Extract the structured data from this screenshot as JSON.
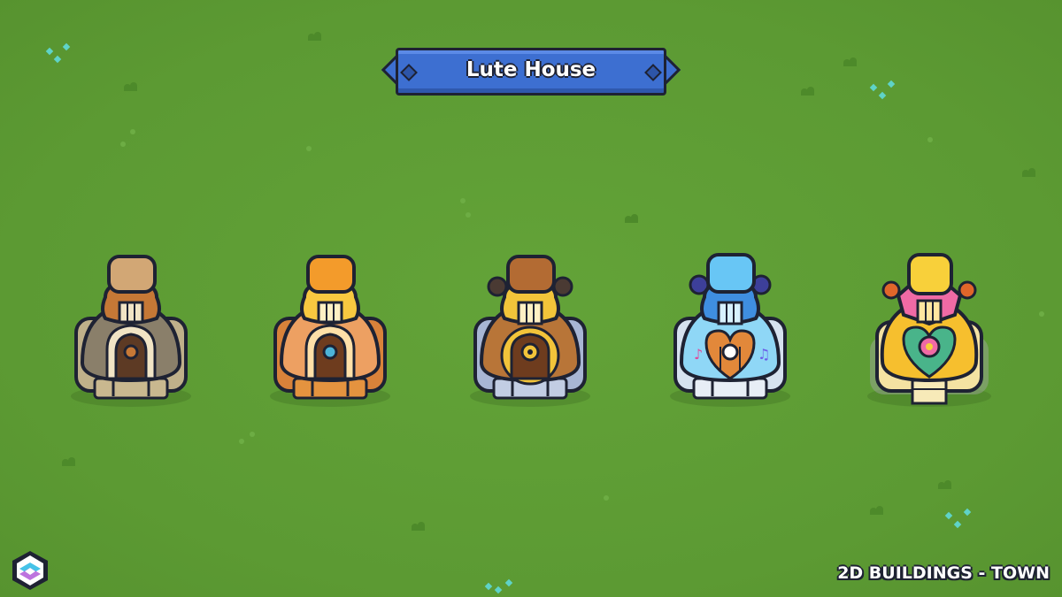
{
  "title": "Lute House",
  "footer_label": "2D BUILDINGS - TOWN",
  "colors": {
    "grass": "#5f9e35",
    "banner": "#3d6fd1",
    "outline": "#1e2233"
  },
  "buildings": [
    {
      "tier": 1,
      "variant": "stone",
      "roof": "#b08a5f",
      "cap": "#d2a775",
      "body": "#8a7f6a",
      "base": "#bfb08a",
      "accent": "#c67836"
    },
    {
      "tier": 2,
      "variant": "orange",
      "roof": "#f39b2b",
      "cap": "#f7b84a",
      "body": "#eda062",
      "base": "#d9823a",
      "accent": "#f8c840"
    },
    {
      "tier": 3,
      "variant": "bronze-gear",
      "roof": "#b36b33",
      "cap": "#cf8a48",
      "body": "#b87538",
      "base": "#a8b6d4",
      "accent": "#f2c43a"
    },
    {
      "tier": 4,
      "variant": "ice-heart",
      "roof": "#3f8ee0",
      "cap": "#68c6f5",
      "body": "#8fd7f6",
      "base": "#d6e2ef",
      "accent": "#e2883a"
    },
    {
      "tier": 5,
      "variant": "royal-gold",
      "roof": "#f06aa5",
      "cap": "#f8d03a",
      "body": "#f6bf2e",
      "base": "#f4e2a2",
      "accent": "#49b48a"
    }
  ],
  "icons": {
    "logo": "hexagon-logo-icon"
  }
}
